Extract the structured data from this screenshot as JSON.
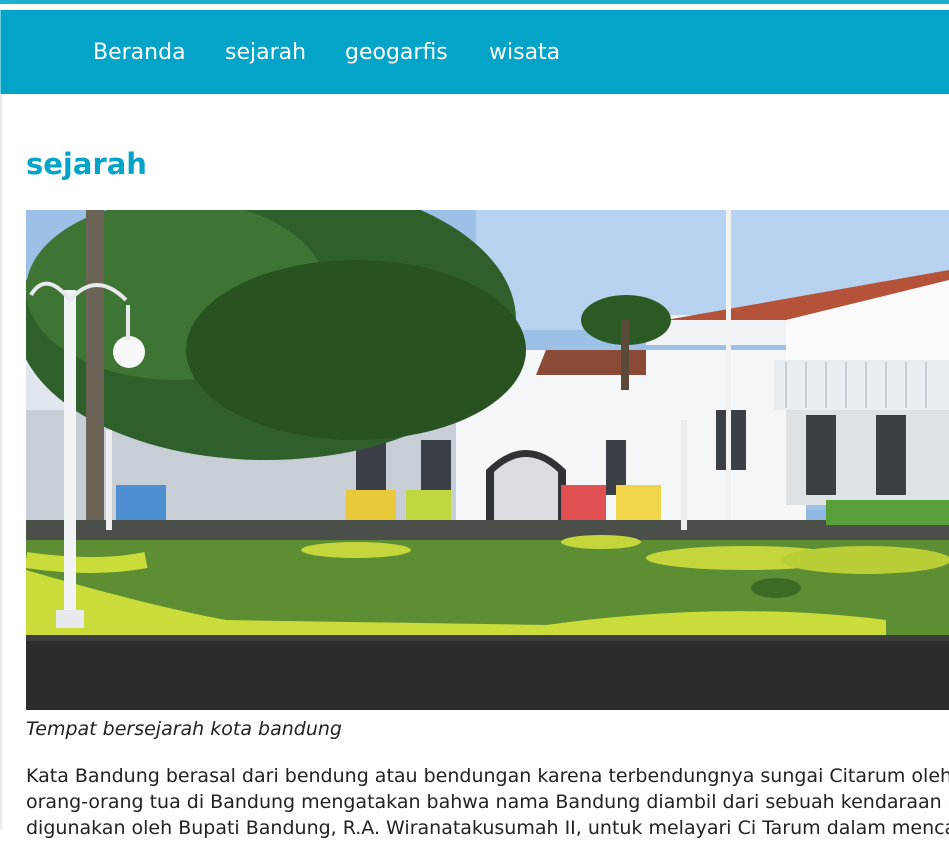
{
  "nav": {
    "items": [
      {
        "label": "Beranda"
      },
      {
        "label": "sejarah"
      },
      {
        "label": "geogarfis"
      },
      {
        "label": "wisata"
      }
    ]
  },
  "page": {
    "title": "sejarah",
    "image_caption": "Tempat bersejarah kota bandung",
    "paragraph_lines": [
      "Kata Bandung berasal dari bendung atau bendungan karena terbendungnya sungai Citarum oleh l",
      "orang-orang tua di Bandung mengatakan bahwa nama Bandung diambil dari sebuah kendaraan air",
      "digunakan oleh Bupati Bandung, R.A. Wiranatakusumah II, untuk melayari Ci Tarum dalam mencar"
    ]
  },
  "colors": {
    "nav_background": "#03a4c8",
    "title": "#03a4c8",
    "body_text": "#222222"
  }
}
